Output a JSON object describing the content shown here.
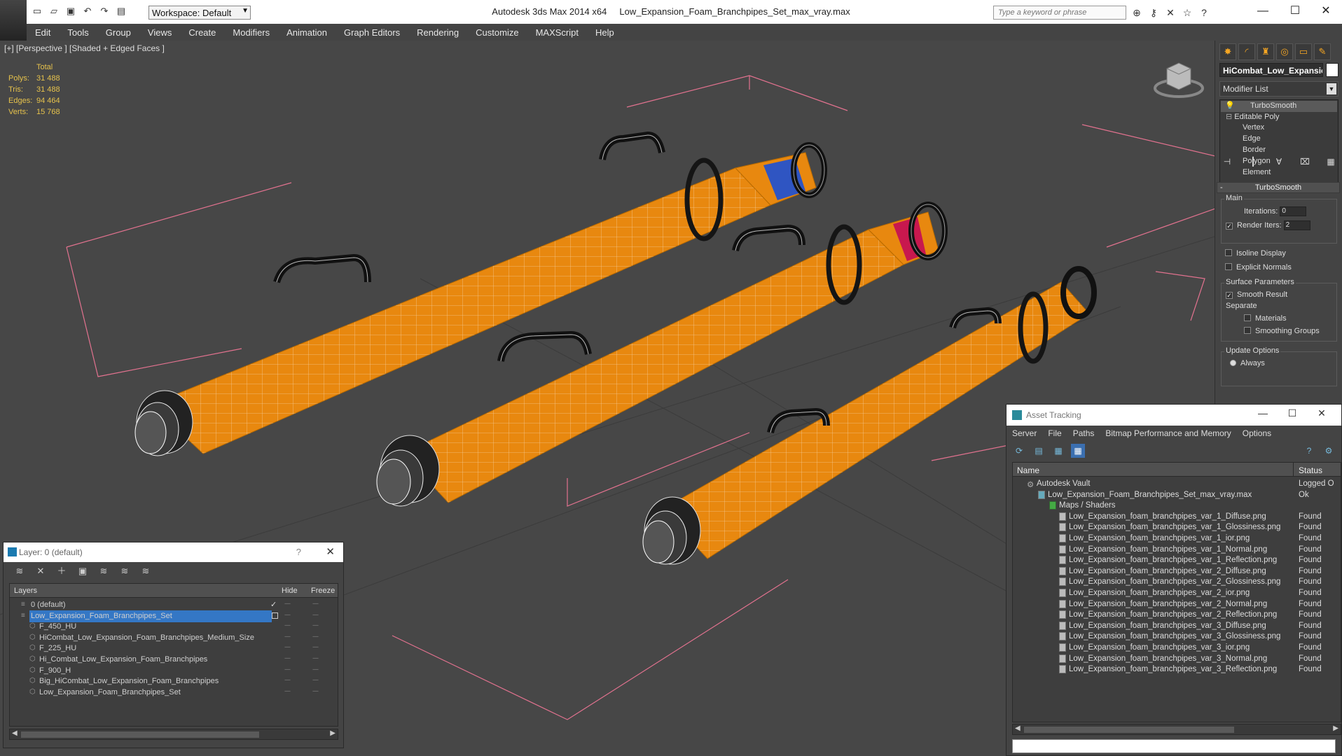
{
  "titlebar": {
    "app_name": "Autodesk 3ds Max  2014 x64",
    "file_name": "Low_Expansion_Foam_Branchpipes_Set_max_vray.max",
    "workspace": "Workspace: Default",
    "search_placeholder": "Type a keyword or phrase",
    "minimize": "—",
    "maximize": "☐",
    "close": "✕"
  },
  "menubar": {
    "items": [
      "Edit",
      "Tools",
      "Group",
      "Views",
      "Create",
      "Modifiers",
      "Animation",
      "Graph Editors",
      "Rendering",
      "Customize",
      "MAXScript",
      "Help"
    ]
  },
  "viewport": {
    "label": "[+] [Perspective ] [Shaded + Edged Faces ]",
    "stats": {
      "header": "Total",
      "rows": [
        {
          "k": "Polys:",
          "v": "31 488"
        },
        {
          "k": "Tris:",
          "v": "31 488"
        },
        {
          "k": "Edges:",
          "v": "94 464"
        },
        {
          "k": "Verts:",
          "v": "15 768"
        }
      ]
    },
    "colors": {
      "pipe": "#e8880f",
      "bg": "#474747",
      "bounds": "#e2728f"
    }
  },
  "command_panel": {
    "object_name": "HiCombat_Low_Expansio",
    "modifier_list": "Modifier List",
    "stack": [
      "TurboSmooth",
      "Editable Poly",
      "Vertex",
      "Edge",
      "Border",
      "Polygon",
      "Element"
    ],
    "rollout_title": "TurboSmooth",
    "main_label": "Main",
    "iterations_label": "Iterations:",
    "iterations_value": "0",
    "render_iters_label": "Render Iters:",
    "render_iters_value": "2",
    "isoline_display": "Isoline Display",
    "explicit_normals": "Explicit Normals",
    "surface_params": "Surface Parameters",
    "smooth_result": "Smooth Result",
    "separate": "Separate",
    "materials": "Materials",
    "smoothing_groups": "Smoothing Groups",
    "update_options": "Update Options",
    "always": "Always"
  },
  "layer_window": {
    "title": "Layer: 0 (default)",
    "help": "?",
    "close": "✕",
    "columns": {
      "layers": "Layers",
      "hide": "Hide",
      "freeze": "Freeze"
    },
    "rows": [
      {
        "name": "0 (default)",
        "indent": 1
      },
      {
        "name": "Low_Expansion_Foam_Branchpipes_Set",
        "indent": 1,
        "selected": true
      },
      {
        "name": "F_450_HU",
        "indent": 2
      },
      {
        "name": "HiCombat_Low_Expansion_Foam_Branchpipes_Medium_Size",
        "indent": 2
      },
      {
        "name": "F_225_HU",
        "indent": 2
      },
      {
        "name": "Hi_Combat_Low_Expansion_Foam_Branchpipes",
        "indent": 2
      },
      {
        "name": "F_900_H",
        "indent": 2
      },
      {
        "name": "Big_HiCombat_Low_Expansion_Foam_Branchpipes",
        "indent": 2
      },
      {
        "name": "Low_Expansion_Foam_Branchpipes_Set",
        "indent": 2
      }
    ],
    "dashes": "----"
  },
  "asset_window": {
    "title": "Asset Tracking",
    "menu": [
      "Server",
      "File",
      "Paths",
      "Bitmap Performance and Memory",
      "Options"
    ],
    "columns": {
      "name": "Name",
      "status": "Status"
    },
    "rows": [
      {
        "name": "Autodesk Vault",
        "status": "Logged O",
        "indent": 0
      },
      {
        "name": "Low_Expansion_Foam_Branchpipes_Set_max_vray.max",
        "status": "Ok",
        "indent": 1
      },
      {
        "name": "Maps / Shaders",
        "status": "",
        "indent": 2
      },
      {
        "name": "Low_Expansion_foam_branchpipes_var_1_Diffuse.png",
        "status": "Found",
        "indent": 3
      },
      {
        "name": "Low_Expansion_foam_branchpipes_var_1_Glossiness.png",
        "status": "Found",
        "indent": 3
      },
      {
        "name": "Low_Expansion_foam_branchpipes_var_1_ior.png",
        "status": "Found",
        "indent": 3
      },
      {
        "name": "Low_Expansion_foam_branchpipes_var_1_Normal.png",
        "status": "Found",
        "indent": 3
      },
      {
        "name": "Low_Expansion_foam_branchpipes_var_1_Reflection.png",
        "status": "Found",
        "indent": 3
      },
      {
        "name": "Low_Expansion_foam_branchpipes_var_2_Diffuse.png",
        "status": "Found",
        "indent": 3
      },
      {
        "name": "Low_Expansion_foam_branchpipes_var_2_Glossiness.png",
        "status": "Found",
        "indent": 3
      },
      {
        "name": "Low_Expansion_foam_branchpipes_var_2_ior.png",
        "status": "Found",
        "indent": 3
      },
      {
        "name": "Low_Expansion_foam_branchpipes_var_2_Normal.png",
        "status": "Found",
        "indent": 3
      },
      {
        "name": "Low_Expansion_foam_branchpipes_var_2_Reflection.png",
        "status": "Found",
        "indent": 3
      },
      {
        "name": "Low_Expansion_foam_branchpipes_var_3_Diffuse.png",
        "status": "Found",
        "indent": 3
      },
      {
        "name": "Low_Expansion_foam_branchpipes_var_3_Glossiness.png",
        "status": "Found",
        "indent": 3
      },
      {
        "name": "Low_Expansion_foam_branchpipes_var_3_ior.png",
        "status": "Found",
        "indent": 3
      },
      {
        "name": "Low_Expansion_foam_branchpipes_var_3_Normal.png",
        "status": "Found",
        "indent": 3
      },
      {
        "name": "Low_Expansion_foam_branchpipes_var_3_Reflection.png",
        "status": "Found",
        "indent": 3
      }
    ]
  }
}
